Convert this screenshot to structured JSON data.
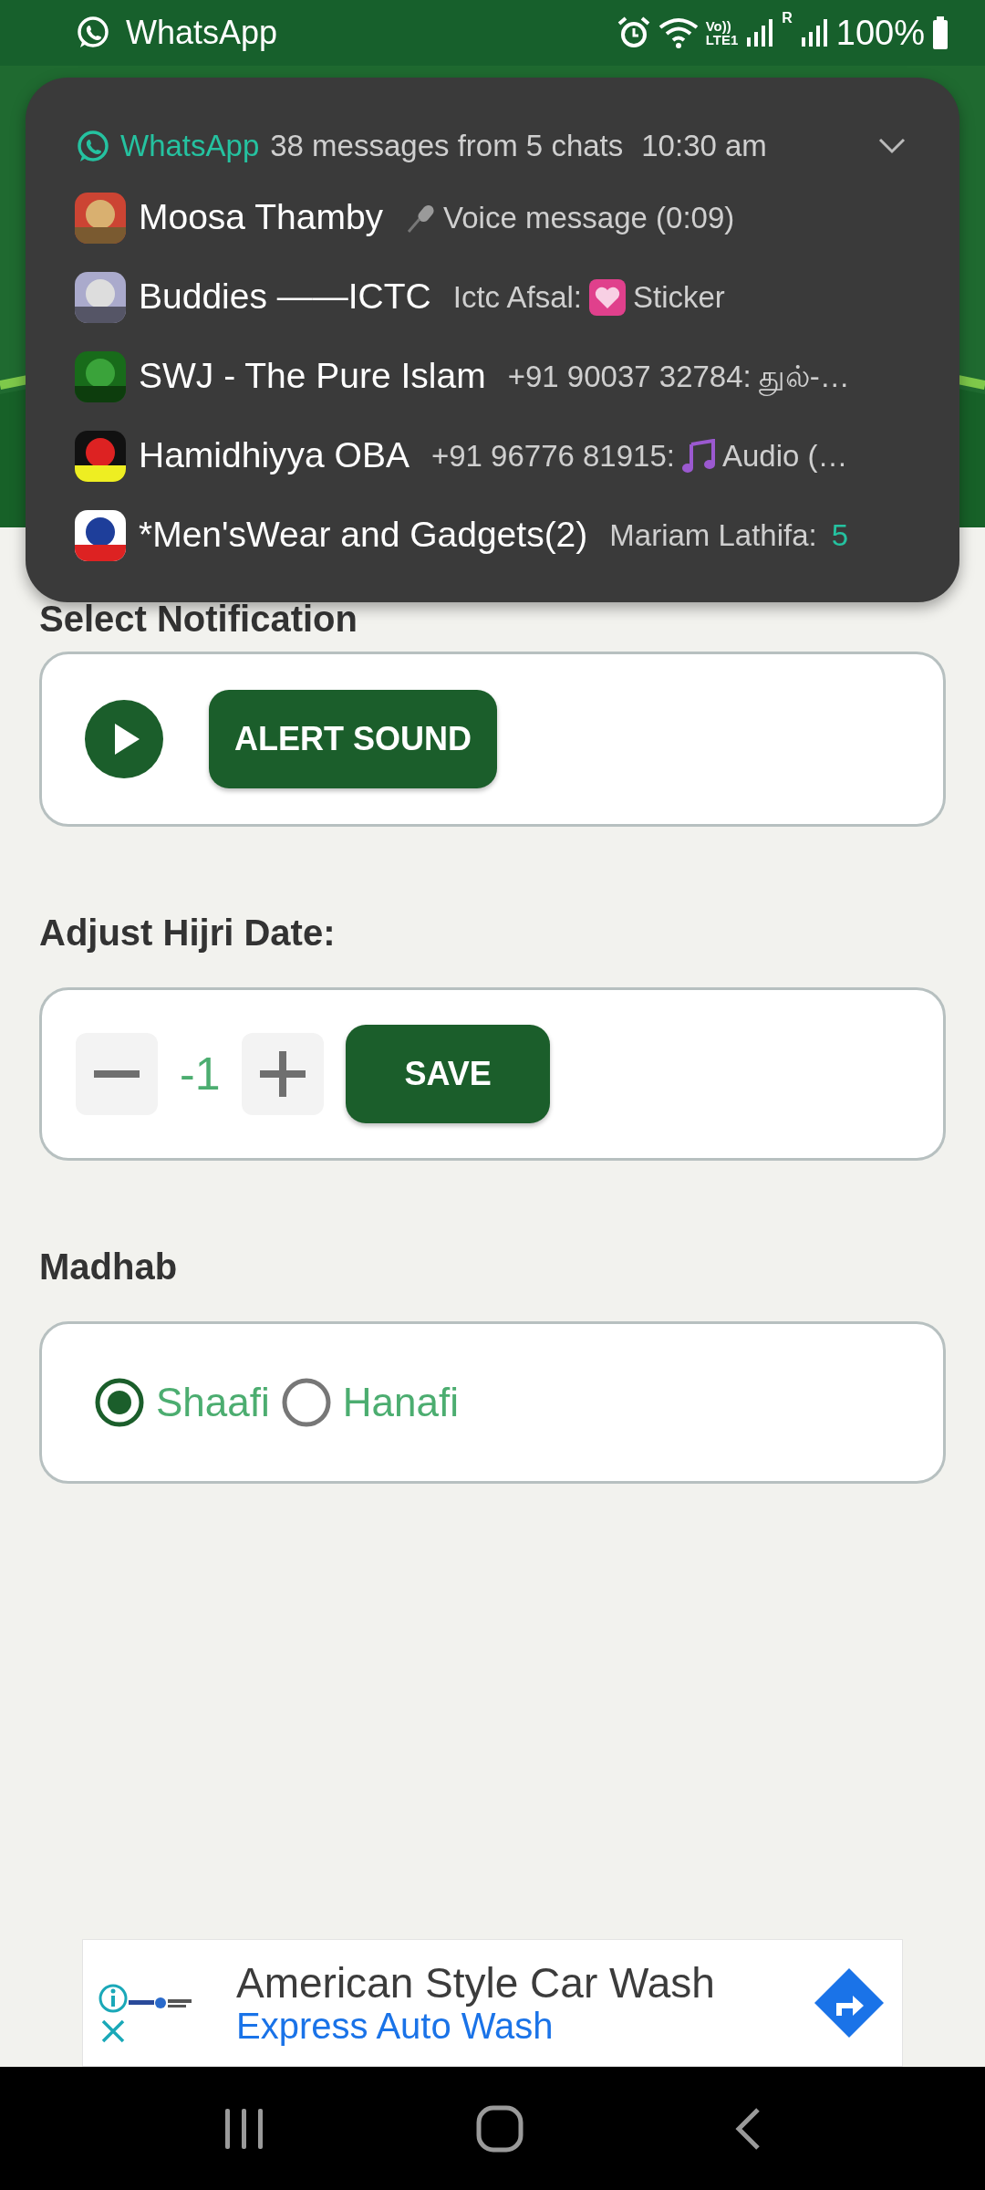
{
  "status_bar": {
    "app": "WhatsApp",
    "volte": "Vo))",
    "lte": "LTE1",
    "roaming": "R",
    "battery": "100%"
  },
  "notification": {
    "app": "WhatsApp",
    "summary": "38 messages from 5 chats",
    "time": "10:30 am",
    "expanded": false,
    "chats": [
      {
        "name": "Moosa Thamby",
        "kind": "voice",
        "text": "Voice message (0:09)"
      },
      {
        "name": "Buddies ——ICTC",
        "sender": "Ictc Afsal:",
        "kind": "sticker",
        "text": "Sticker"
      },
      {
        "name": "SWJ - The Pure Islam",
        "sender": "+91 90037 32784:",
        "kind": "text",
        "text": "துல்-…"
      },
      {
        "name": "Hamidhiyya OBA",
        "sender": "+91 96776 81915:",
        "kind": "audio",
        "text": "Audio (…"
      },
      {
        "name": "*Men'sWear and Gadgets(2)",
        "sender": "Mariam Lathifa:",
        "kind": "text",
        "count": "5"
      }
    ]
  },
  "sections": [
    {
      "kind": "sound",
      "title": "Select Notification",
      "button": "ALERT SOUND"
    },
    {
      "kind": "stepper",
      "title": "Adjust Hijri Date:",
      "value": "-1",
      "button": "SAVE"
    },
    {
      "kind": "radio",
      "title": "Madhab",
      "options": [
        {
          "label": "Shaafi",
          "selected": true
        },
        {
          "label": "Hanafi",
          "selected": false
        }
      ]
    }
  ],
  "ad": {
    "headline": "American Style Car Wash",
    "advertiser": "Express Auto Wash"
  }
}
